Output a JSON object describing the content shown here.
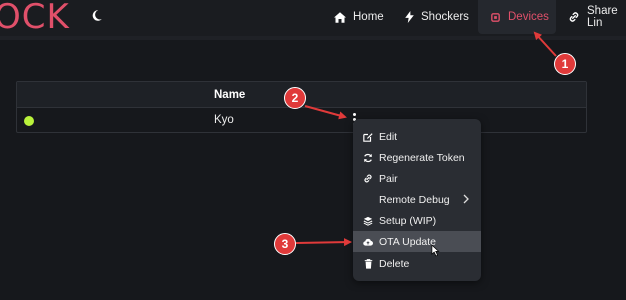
{
  "app": {
    "logo_text": "OCK"
  },
  "nav": {
    "home": {
      "label": "Home",
      "icon": "home-icon"
    },
    "shockers": {
      "label": "Shockers",
      "icon": "bolt-icon"
    },
    "devices": {
      "label": "Devices",
      "icon": "chip-icon",
      "active": true
    },
    "share": {
      "label": "Share Lin",
      "icon": "link-icon"
    }
  },
  "table": {
    "header": {
      "name": "Name"
    },
    "rows": [
      {
        "status": "online",
        "status_color": "#b9f23b",
        "name": "Kyo"
      }
    ]
  },
  "context_menu": {
    "items": [
      {
        "label": "Edit",
        "icon": "edit-icon"
      },
      {
        "label": "Regenerate Token",
        "icon": "refresh-icon"
      },
      {
        "label": "Pair",
        "icon": "link-icon"
      },
      {
        "label": "Remote Debug",
        "icon": "",
        "has_submenu": true
      },
      {
        "label": "Setup (WIP)",
        "icon": "layers-icon"
      },
      {
        "label": "OTA Update",
        "icon": "cloud-upload-icon",
        "hovered": true
      },
      {
        "label": "Delete",
        "icon": "trash-icon"
      }
    ]
  },
  "annotations": {
    "step1": "1",
    "step2": "2",
    "step3": "3"
  },
  "colors": {
    "accent": "#e0506a",
    "annotation": "#e03a3a",
    "background": "#16181c"
  }
}
